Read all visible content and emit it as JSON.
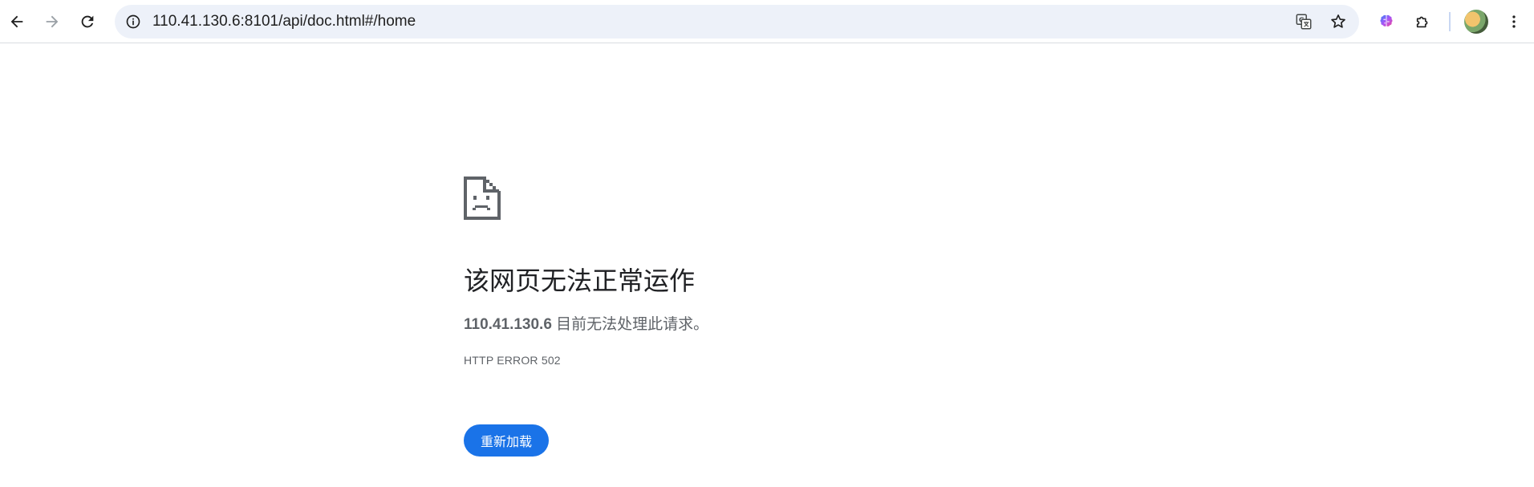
{
  "toolbar": {
    "back_icon": "arrow-left-icon",
    "forward_icon": "arrow-right-icon",
    "reload_icon": "reload-icon",
    "omnibox": {
      "site_info_icon": "info-icon",
      "url": "110.41.130.6:8101/api/doc.html#/home",
      "translate_icon": "translate-icon",
      "bookmark_icon": "star-icon"
    },
    "extensions": [
      "ai-assistant-icon",
      "puzzle-icon"
    ],
    "avatar_icon": "profile-avatar",
    "menu_icon": "more-vertical-icon"
  },
  "error": {
    "icon": "sad-document-icon",
    "title": "该网页无法正常运作",
    "host": "110.41.130.6",
    "message": " 目前无法处理此请求。",
    "code": "HTTP ERROR 502",
    "reload_label": "重新加载"
  },
  "colors": {
    "accent": "#1a73e8",
    "omnibox_bg": "#edf1f9",
    "text_primary": "#202124",
    "text_secondary": "#5f6368"
  }
}
